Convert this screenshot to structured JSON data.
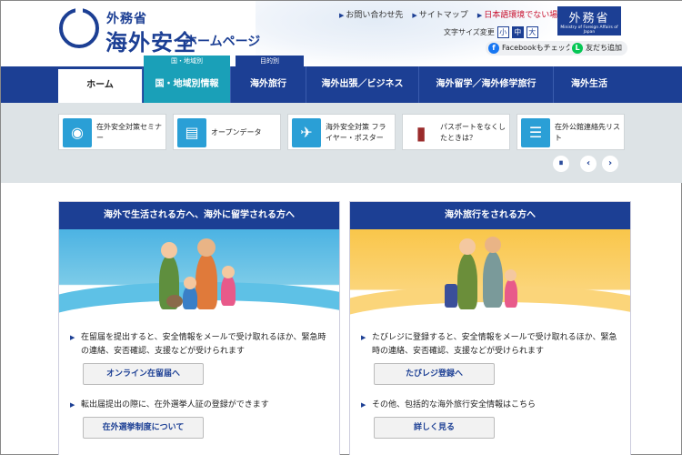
{
  "header": {
    "ministry": "外務省",
    "site_title": "海外安全",
    "site_subtitle": "ホームページ",
    "links": {
      "contact": "お問い合わせ先",
      "sitemap": "サイトマップ",
      "language": "日本語環境でない場合"
    },
    "font_size_label": "文字サイズ変更",
    "font_sizes": [
      "小",
      "中",
      "大"
    ],
    "font_size_selected": "中",
    "mofa_badge_jp": "外務省",
    "mofa_badge_en": "Ministry of Foreign Affairs of Japan",
    "facebook": "Facebookもチェック",
    "line": "友だち追加"
  },
  "nav": {
    "category_labels": {
      "region": "国・地域別",
      "purpose": "目的別"
    },
    "items": [
      "ホーム",
      "国・地域別情報",
      "海外旅行",
      "海外出張／ビジネス",
      "海外留学／海外修学旅行",
      "海外生活"
    ],
    "active": "ホーム"
  },
  "shortcuts": [
    {
      "label": "在外安全対策セミナー",
      "icon": "seminar-icon"
    },
    {
      "label": "オープンデータ",
      "icon": "document-icon"
    },
    {
      "label": "海外安全対策 フライヤー・ポスター",
      "icon": "airplane-luggage-icon"
    },
    {
      "label": "パスポートをなくしたときは？",
      "icon": "passport-icon"
    },
    {
      "label": "在外公館連絡先リスト",
      "icon": "contact-list-icon"
    }
  ],
  "slider_controls": {
    "pause": "⏸",
    "prev": "‹",
    "next": "›"
  },
  "cards": [
    {
      "title": "海外で生活される方へ、海外に留学される方へ",
      "text1": "在留届を提出すると、安全情報をメールで受け取れるほか、緊急時の連絡、安否確認、支援などが受けられます",
      "button1": "オンライン在留届へ",
      "text2": "転出届提出の際に、在外選挙人証の登録ができます",
      "button2": "在外選挙制度について"
    },
    {
      "title": "海外旅行をされる方へ",
      "text1": "たびレジに登録すると、安全情報をメールで受け取れるほか、緊急時の連絡、安否確認、支援などが受けられます",
      "button1": "たびレジ登録へ",
      "text2": "その他、包括的な海外旅行安全情報はこちら",
      "button2": "詳しく見る"
    }
  ],
  "colors": {
    "brand_blue": "#1c3f94",
    "teal": "#1aa0b8",
    "band_gray": "#dde3e6",
    "sky_blue": "#4cb3e3",
    "sun_yellow": "#f9c64a"
  }
}
